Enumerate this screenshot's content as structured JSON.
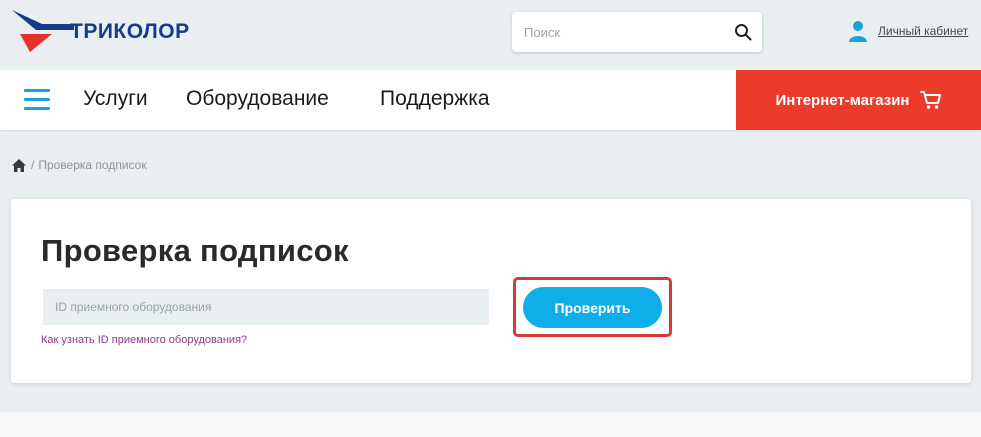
{
  "brand": {
    "name": "ТРИКОЛОР"
  },
  "search": {
    "placeholder": "Поиск",
    "value": ""
  },
  "account": {
    "label": "Личный кабинет"
  },
  "nav": {
    "items": [
      {
        "label": "Услуги"
      },
      {
        "label": "Оборудование"
      },
      {
        "label": "Поддержка"
      }
    ],
    "shop_label": "Интернет-магазин"
  },
  "breadcrumb": {
    "separator": "/",
    "current": "Проверка подписок"
  },
  "check_form": {
    "title": "Проверка подписок",
    "id_placeholder": "ID приемного оборудования",
    "id_value": "",
    "help_link": "Как узнать ID приемного оборудования?",
    "submit_label": "Проверить"
  },
  "colors": {
    "accent_blue": "#0eaee8",
    "brand_red": "#ec3a2b",
    "brand_navy": "#173b8a",
    "highlight_red": "#d43c3c",
    "link_purple": "#8e3b86"
  },
  "icons": [
    "logo-icon",
    "search-icon",
    "user-icon",
    "menu-icon",
    "cart-icon",
    "home-icon"
  ]
}
